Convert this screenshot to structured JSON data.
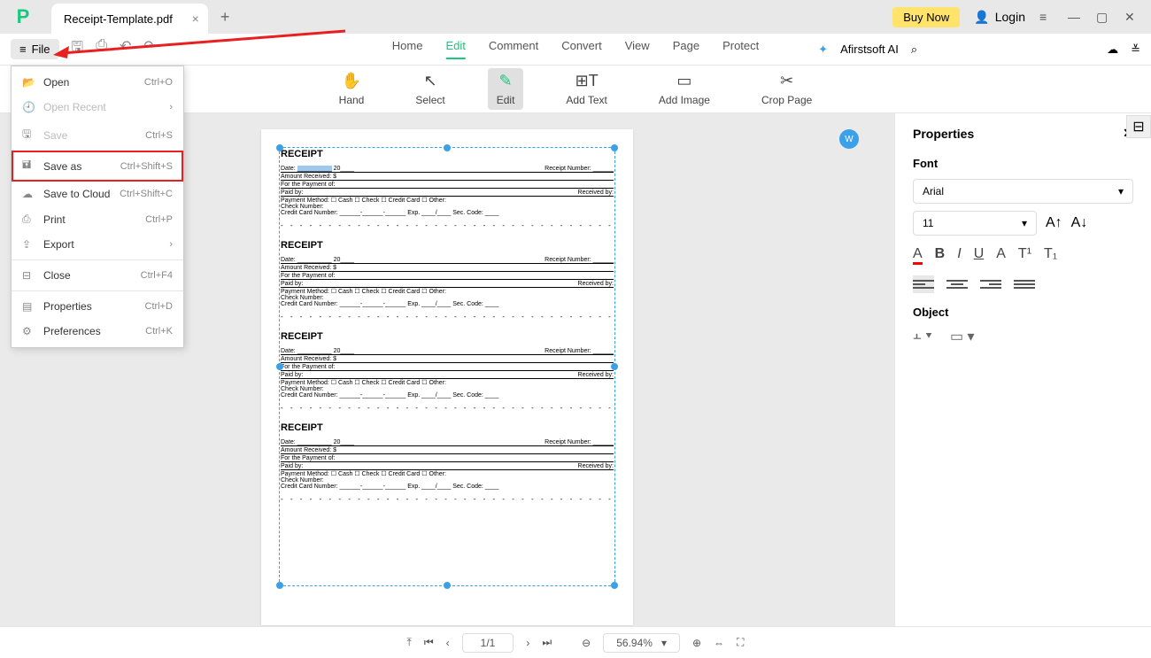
{
  "titlebar": {
    "tab_name": "Receipt-Template.pdf",
    "buy_now": "Buy Now",
    "login": "Login"
  },
  "file_button": "File",
  "top_tabs": {
    "home": "Home",
    "edit": "Edit",
    "comment": "Comment",
    "convert": "Convert",
    "view": "View",
    "page": "Page",
    "protect": "Protect"
  },
  "ai": "Afirstsoft AI",
  "toolbar": {
    "hand": "Hand",
    "select": "Select",
    "edit": "Edit",
    "add_text": "Add Text",
    "add_image": "Add Image",
    "crop": "Crop Page"
  },
  "file_menu": {
    "open": {
      "label": "Open",
      "shortcut": "Ctrl+O"
    },
    "open_recent": {
      "label": "Open Recent",
      "shortcut": ""
    },
    "save": {
      "label": "Save",
      "shortcut": "Ctrl+S"
    },
    "save_as": {
      "label": "Save as",
      "shortcut": "Ctrl+Shift+S"
    },
    "save_cloud": {
      "label": "Save to Cloud",
      "shortcut": "Ctrl+Shift+C"
    },
    "print": {
      "label": "Print",
      "shortcut": "Ctrl+P"
    },
    "export": {
      "label": "Export",
      "shortcut": ""
    },
    "close": {
      "label": "Close",
      "shortcut": "Ctrl+F4"
    },
    "properties": {
      "label": "Properties",
      "shortcut": "Ctrl+D"
    },
    "preferences": {
      "label": "Preferences",
      "shortcut": "Ctrl+K"
    }
  },
  "properties_panel": {
    "title": "Properties",
    "font_label": "Font",
    "font_family": "Arial",
    "font_size": "11",
    "object_label": "Object"
  },
  "receipt": {
    "title": "RECEIPT",
    "date": "Date:",
    "date_val": "20",
    "receipt_num": "Receipt Number:",
    "amount": "Amount Received: $",
    "payment_of": "For the Payment of:",
    "paid_by": "Paid by:",
    "received_by": "Received by:",
    "method": "Payment Method: ☐ Cash ☐ Check ☐ Credit Card ☐ Other:",
    "check": "Check Number:",
    "cc": "Credit Card Number: ______-______-______ Exp. ____/____ Sec. Code: ____"
  },
  "status": {
    "page": "1/1",
    "zoom": "56.94%"
  }
}
